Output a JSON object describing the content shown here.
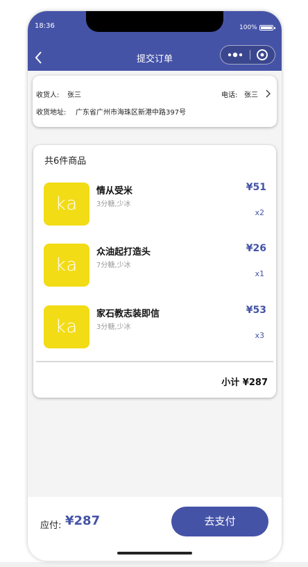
{
  "status_bar": {
    "time": "18:36",
    "battery": "100%"
  },
  "nav": {
    "title": "提交订单",
    "back_icon": "chevron-left-icon",
    "more_icon": "more-dots-icon",
    "close_icon": "close-circle-icon"
  },
  "address": {
    "receiver_label": "收货人:",
    "receiver_name": "张三",
    "phone_label": "电话:",
    "phone_value": "张三",
    "address_label": "收货地址:",
    "address_value": "广东省广州市海珠区新港中路397号"
  },
  "goods": {
    "count_text": "共6件商品",
    "items": [
      {
        "thumb_text": "ka",
        "name": "情从受米",
        "spec": "3分糖,少冰",
        "price": "¥51",
        "qty": "x2"
      },
      {
        "thumb_text": "ka",
        "name": "众油起打造头",
        "spec": "7分糖,少冰",
        "price": "¥26",
        "qty": "x1"
      },
      {
        "thumb_text": "ka",
        "name": "家石教志装即信",
        "spec": "3分糖,少冰",
        "price": "¥53",
        "qty": "x3"
      }
    ],
    "subtotal_text": "小计 ¥287"
  },
  "footer": {
    "pay_label": "应付:",
    "pay_amount": "¥287",
    "pay_button": "去支付"
  },
  "colors": {
    "primary": "#4553a7",
    "thumb": "#f2dc15",
    "background": "#f4f4f4"
  }
}
